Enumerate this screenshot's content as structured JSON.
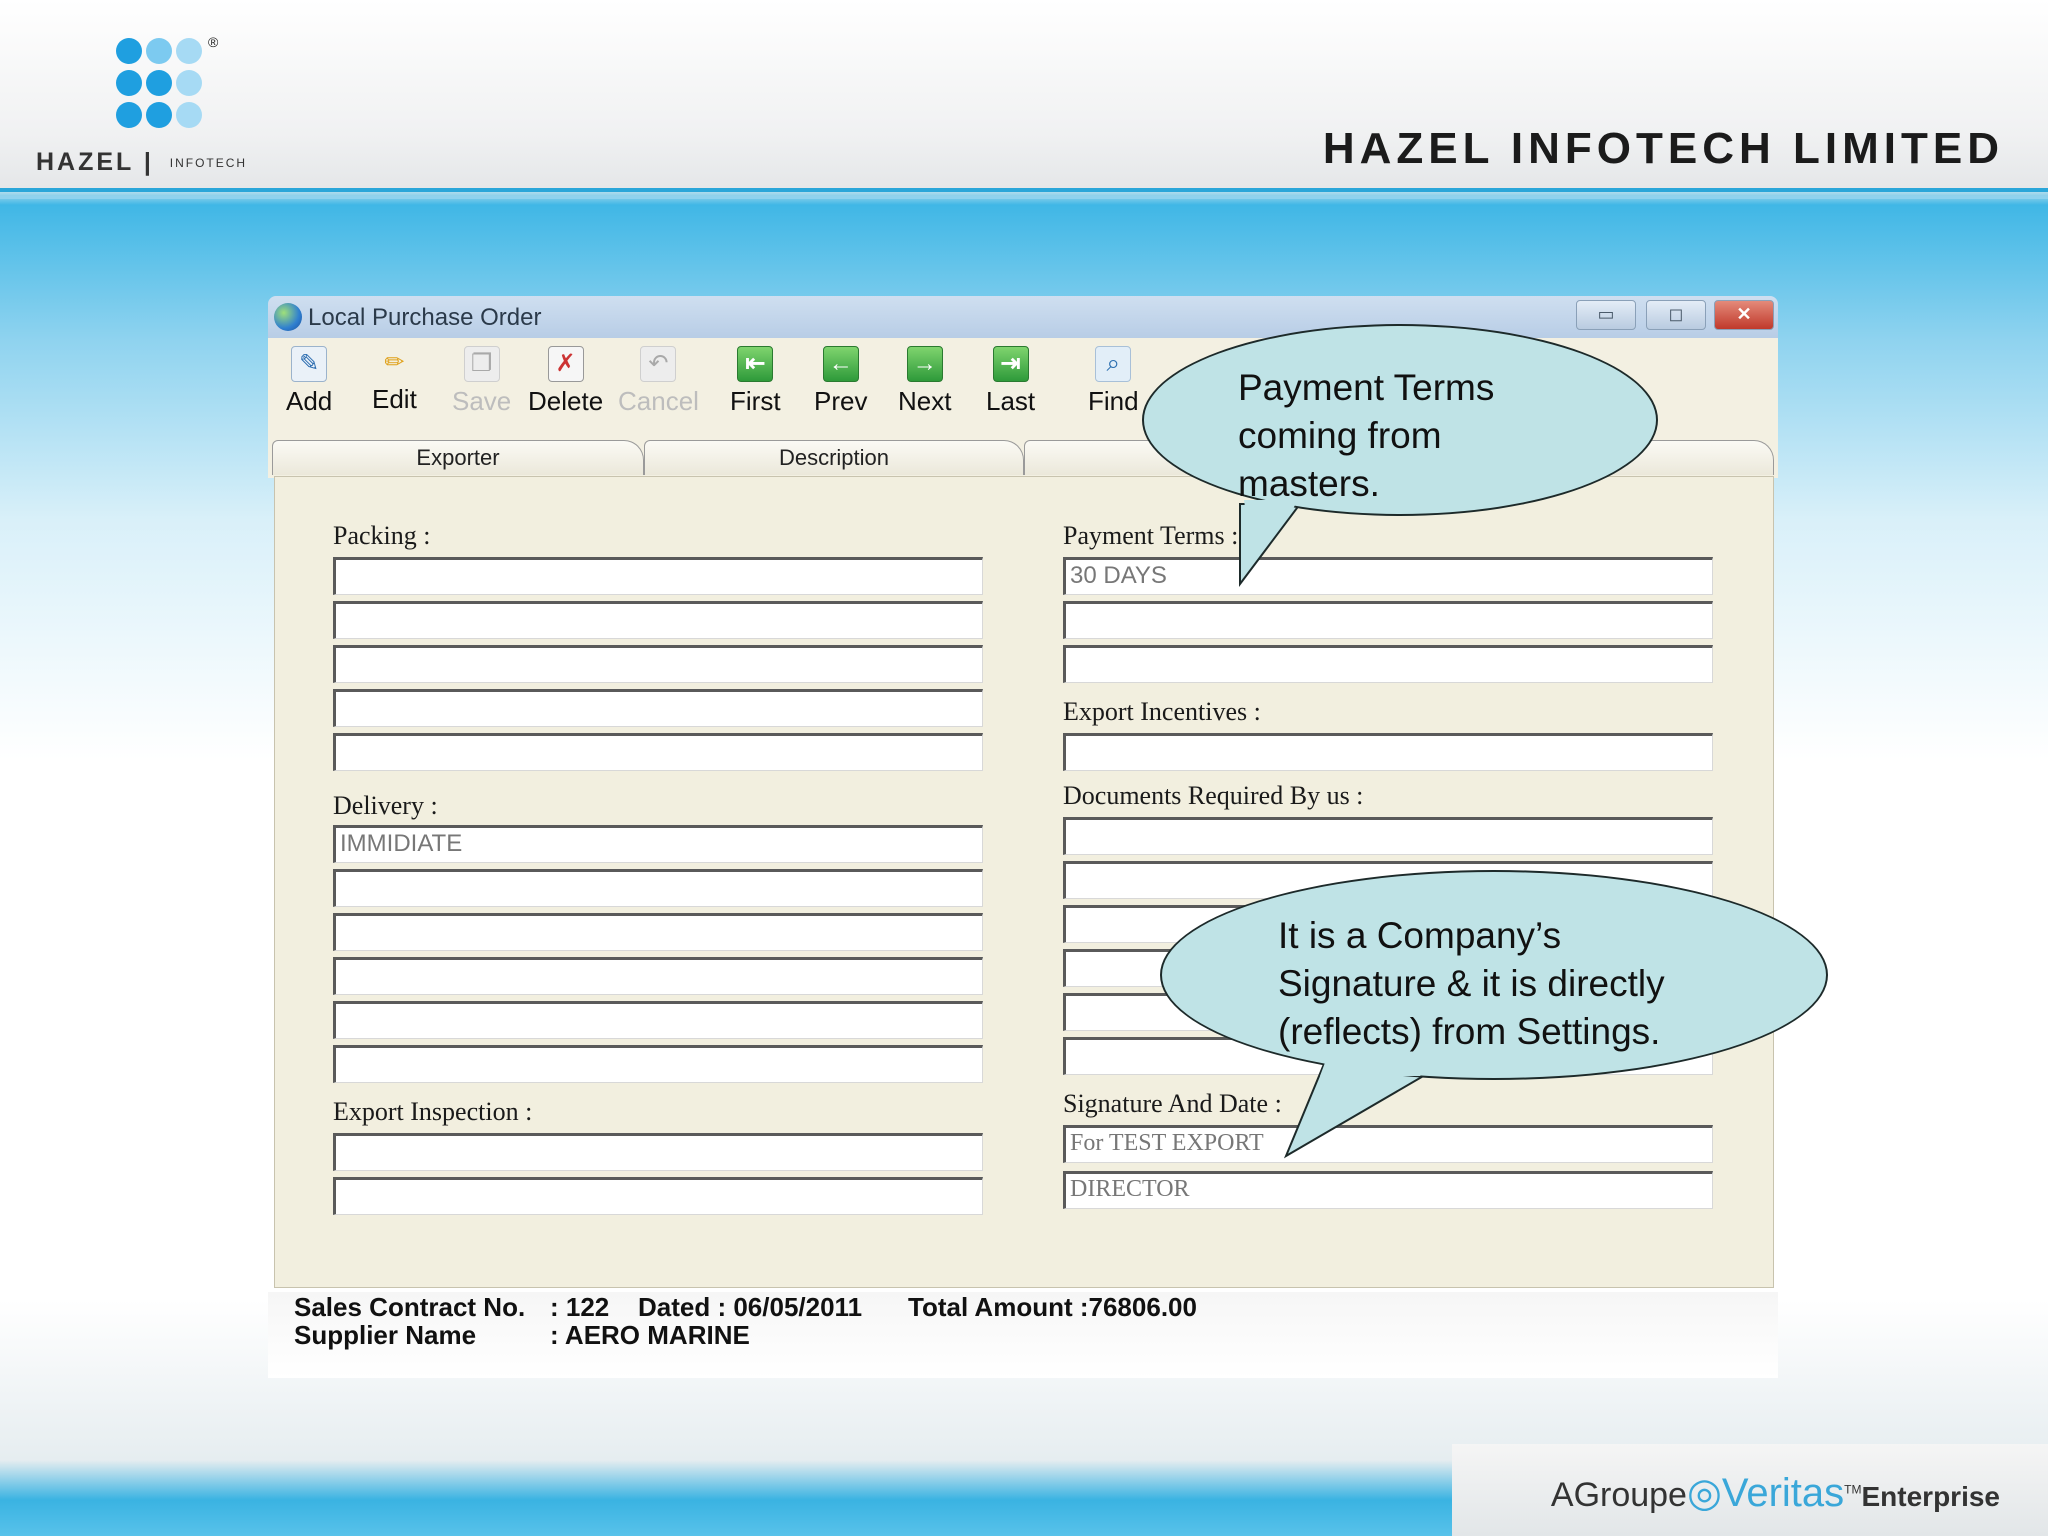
{
  "brand": {
    "logo_text": "HAZEL",
    "logo_sub": "INFOTECH",
    "company_name": "HAZEL INFOTECH LIMITED",
    "footer_prefix": "A",
    "footer_group": "Groupe",
    "footer_veritas": "Veritas",
    "footer_tm": "TM",
    "footer_enterprise": "Enterprise",
    "accent_color": "#2aa6d9"
  },
  "window": {
    "title": "Local Purchase Order",
    "controls": {
      "minimize": "▭",
      "maximize": "◻",
      "close": "✕"
    }
  },
  "toolbar": {
    "add": "Add",
    "edit": "Edit",
    "save": "Save",
    "delete": "Delete",
    "cancel": "Cancel",
    "first": "First",
    "prev": "Prev",
    "next": "Next",
    "last": "Last",
    "find": "Find"
  },
  "tabs": [
    "Exporter",
    "Description"
  ],
  "form": {
    "packing_label": "Packing :",
    "packing_values": [
      "",
      "",
      "",
      "",
      ""
    ],
    "delivery_label": "Delivery :",
    "delivery_values": [
      "IMMIDIATE",
      "",
      "",
      "",
      "",
      ""
    ],
    "export_inspection_label": "Export Inspection :",
    "export_inspection_values": [
      "",
      ""
    ],
    "payment_terms_label": "Payment Terms :",
    "payment_terms_values": [
      "30 DAYS",
      "",
      ""
    ],
    "export_incentives_label": "Export Incentives :",
    "export_incentives_values": [
      ""
    ],
    "documents_label": "Documents Required By us :",
    "documents_values": [
      "",
      "",
      "",
      "",
      "",
      ""
    ],
    "signature_label": "Signature And Date :",
    "signature_values": [
      "For TEST EXPORT",
      "DIRECTOR"
    ]
  },
  "status": {
    "contract_label": "Sales Contract No.",
    "contract_value": ": 122",
    "dated": "Dated : 06/05/2011",
    "total": "Total Amount :76806.00",
    "supplier_label": "Supplier Name",
    "supplier_value": ": AERO MARINE"
  },
  "callouts": {
    "payment": [
      "Payment Terms",
      "coming from",
      "masters."
    ],
    "signature": [
      "It is a Company’s",
      "Signature & it is directly",
      "(reflects) from Settings."
    ]
  }
}
